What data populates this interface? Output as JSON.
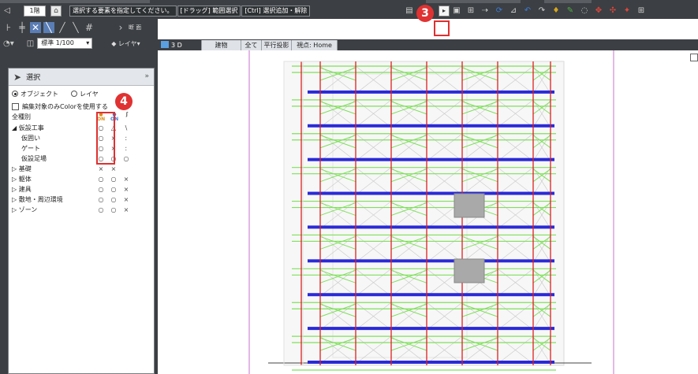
{
  "toolbar": {
    "floor_value": "1階",
    "home_icon": "home-icon",
    "select_prompt": "選択する要素を指定してください。",
    "drag_hint": "[ドラッグ] 範囲選択",
    "ctrl_hint": "[Ctrl] 選択追加・解除",
    "scale_value": "標準 1/100",
    "layer_label": "レイヤ",
    "cut_label": "断 面"
  },
  "callouts": {
    "step3": "3",
    "step4": "4",
    "color": "#e03232"
  },
  "palette": {
    "title": "選択",
    "radio_object": "オブジェクト",
    "radio_layer": "レイヤ",
    "selected_radio": "オブジェクト",
    "checkbox_label": "編集対象のみColorを使用する",
    "tree_root": "全種別",
    "column_icons": [
      "visibility-bulb-icon",
      "selectable-bulb-icon",
      "lock-icon"
    ],
    "rows": [
      {
        "name": "◢ 仮設工事",
        "indent": 0,
        "m1": "○",
        "m2": "△",
        "m3": "\\"
      },
      {
        "name": "仮囲い",
        "indent": 1,
        "m1": "○",
        "m2": "×",
        "m3": "ː"
      },
      {
        "name": "ゲート",
        "indent": 1,
        "m1": "○",
        "m2": "×",
        "m3": "ː"
      },
      {
        "name": "仮設足場",
        "indent": 1,
        "m1": "○",
        "m2": "○",
        "m3": "○"
      },
      {
        "name": "▷ 基礎",
        "indent": 0,
        "m1": "×",
        "m2": "×",
        "m3": ""
      },
      {
        "name": "▷ 躯体",
        "indent": 0,
        "m1": "○",
        "m2": "○",
        "m3": "×"
      },
      {
        "name": "▷ 建具",
        "indent": 0,
        "m1": "○",
        "m2": "○",
        "m3": "×"
      },
      {
        "name": "▷ 敷地・周辺環境",
        "indent": 0,
        "m1": "○",
        "m2": "○",
        "m3": "×"
      },
      {
        "name": "▷ ゾーン",
        "indent": 0,
        "m1": "○",
        "m2": "○",
        "m3": "×"
      }
    ]
  },
  "tabs": [
    {
      "label": "3 D"
    },
    {
      "label": "建物"
    },
    {
      "label": "全て"
    },
    {
      "label": "平行投影"
    },
    {
      "label": "視点: Home"
    }
  ],
  "colors": {
    "scaffold_red": "#e02020",
    "scaffold_green": "#7ee05a",
    "scaffold_blue": "#2a2ad8",
    "guide_magenta": "#c86fd0"
  }
}
